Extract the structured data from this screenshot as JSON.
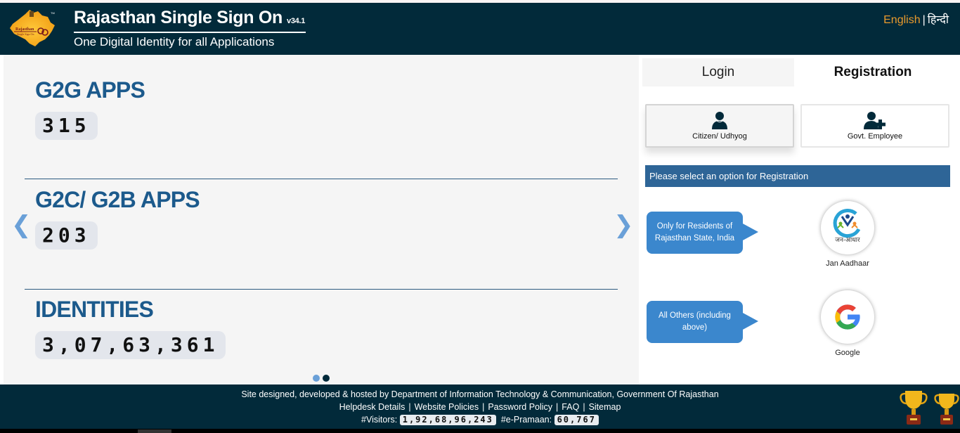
{
  "header": {
    "title": "Rajasthan Single Sign On",
    "version": "v34.1",
    "subtitle": "One Digital Identity for all Applications",
    "logo_alt": "Rajasthan Single Sign On",
    "lang": {
      "english": "English",
      "separator": "|",
      "hindi": "हिन्दी"
    }
  },
  "stats": [
    {
      "label": "G2G APPS",
      "value": "315"
    },
    {
      "label": "G2C/ G2B APPS",
      "value": "203"
    },
    {
      "label": "IDENTITIES",
      "value": "3,07,63,361"
    }
  ],
  "carousel": {
    "prev_icon": "chevron-left-icon",
    "next_icon": "chevron-right-icon",
    "prev_glyph": "❮",
    "next_glyph": "❯",
    "active_slide": 2,
    "slides": 2,
    "colors": {
      "inactive_dot": "#6aa0d8",
      "active_dot": "#022a3a"
    }
  },
  "auth": {
    "tabs": [
      {
        "label": "Login",
        "active": false
      },
      {
        "label": "Registration",
        "active": true
      }
    ],
    "options": [
      {
        "label": "Citizen/ Udhyog",
        "icon": "user-icon",
        "selected": true
      },
      {
        "label": "Govt. Employee",
        "icon": "user-plus-icon",
        "selected": false
      }
    ],
    "banner": "Please select an option for Registration",
    "providers": [
      {
        "hint": "Only for Residents of Rajasthan State, India",
        "label": "Jan Aadhaar",
        "logo_text": "जन-आधार",
        "icon": "jan-aadhaar-logo-icon"
      },
      {
        "hint": "All Others (including above)",
        "label": "Google",
        "icon": "google-logo-icon"
      }
    ]
  },
  "footer": {
    "credit": "Site designed, developed & hosted by Department of Information Technology & Communication, Government Of Rajasthan",
    "links": [
      "Helpdesk Details",
      "Website Policies",
      "Password Policy",
      "FAQ",
      "Sitemap"
    ],
    "link_separator": "|",
    "visitors_label": "#Visitors:",
    "visitors_value": "1,92,68,96,243",
    "epramaan_label": "#e-Pramaan:",
    "epramaan_value": "60,767"
  },
  "colors": {
    "header_bg": "#022a3a",
    "accent_lang": "#e99a2c",
    "stat_heading": "#1c5a8c",
    "banner_bg": "#2e6597",
    "bubble_bg": "#3b87cd"
  }
}
